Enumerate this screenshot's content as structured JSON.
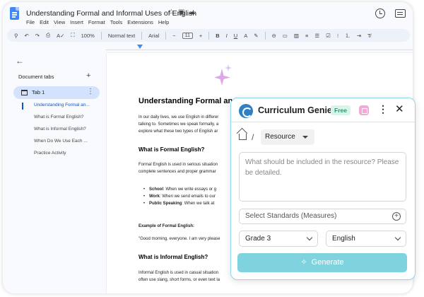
{
  "doc": {
    "title": "Understanding Formal and Informal Uses of English",
    "menu": [
      "File",
      "Edit",
      "View",
      "Insert",
      "Format",
      "Tools",
      "Extensions",
      "Help"
    ]
  },
  "toolbar": {
    "zoom": "100%",
    "style": "Normal text",
    "font": "Arial",
    "font_size": "11"
  },
  "sidebar": {
    "heading": "Document tabs",
    "tab_label": "Tab 1",
    "outline": [
      "Understanding Formal an...",
      "What is Formal English?",
      "What is Informal English?",
      "When Do We Use Each ...",
      "Practice Activity"
    ]
  },
  "page": {
    "title": "Understanding Formal and Informal Uses of English",
    "intro": [
      "In our daily lives, we use English in differer",
      "talking to. Sometimes we speak formally, a",
      "explore what these two types of English ar"
    ],
    "h_formal": "What is Formal English?",
    "formal_para": [
      "Formal English is used in serious situation",
      "complete sentences and proper grammar"
    ],
    "bullets": [
      {
        "term": "School",
        "text": ": When we write essays or g"
      },
      {
        "term": "Work",
        "text": ": When we send emails to our"
      },
      {
        "term": "Public Speaking",
        "text": ": When we talk at"
      }
    ],
    "example_label": "Example of Formal English:",
    "example_quote": "\"Good morning, everyone. I am very please",
    "h_informal": "What is Informal English?",
    "informal_para": [
      "Informal English is used in casual situation",
      "often use slang, short forms, or even text la"
    ]
  },
  "genie": {
    "title": "Curriculum Genie",
    "badge": "Free",
    "breadcrumb_sep": "/",
    "resource_label": "Resource",
    "textarea_placeholder": "What should be included in the resource? Please be detailed.",
    "standards_placeholder": "Select Standards (Measures)",
    "grade": "Grade 3",
    "language": "English",
    "generate_label": "Generate",
    "accent_color": "#7fd3df"
  }
}
